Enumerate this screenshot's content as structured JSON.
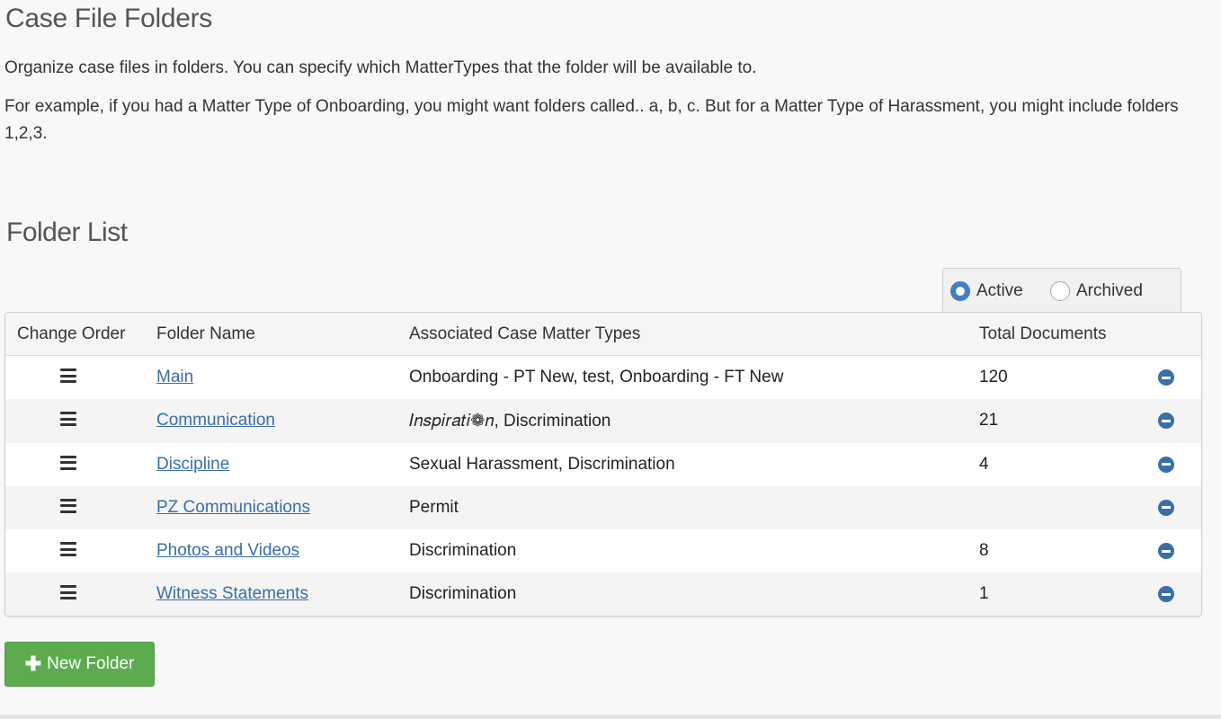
{
  "page": {
    "title": "Case File Folders",
    "intro_line1": "Organize case files in folders. You can specify which MatterTypes that the folder will be available to.",
    "intro_line2": "For example, if you had a Matter Type of Onboarding, you might want folders called.. a, b, c. But for a Matter Type of Harassment, you might include folders 1,2,3."
  },
  "folder_list": {
    "title": "Folder List",
    "filter": {
      "active_label": "Active",
      "archived_label": "Archived",
      "selected": "Active"
    },
    "columns": [
      "Change Order",
      "Folder Name",
      "Associated Case Matter Types",
      "Total Documents"
    ],
    "rows": [
      {
        "name": "Main",
        "types": "Onboarding - PT New, test, Onboarding - FT New",
        "total": "120"
      },
      {
        "name": "Communication",
        "types": "𝐼𝑛𝑠𝑝𝑖𝑟𝑎𝑡𝑖❁𝑛, Discrimination",
        "total": "21"
      },
      {
        "name": "Discipline",
        "types": "Sexual Harassment, Discrimination",
        "total": "4"
      },
      {
        "name": "PZ Communications",
        "types": "Permit",
        "total": ""
      },
      {
        "name": "Photos and Videos",
        "types": "Discrimination",
        "total": "8"
      },
      {
        "name": "Witness Statements",
        "types": "Discrimination",
        "total": "1"
      }
    ]
  },
  "actions": {
    "new_folder_label": "New Folder",
    "new_folder_icon": "plus-icon"
  },
  "colors": {
    "link": "#3a6ea5",
    "radio_selected": "#3f7fc2",
    "remove_icon": "#3b6ea8",
    "new_button": "#5cac4f"
  }
}
